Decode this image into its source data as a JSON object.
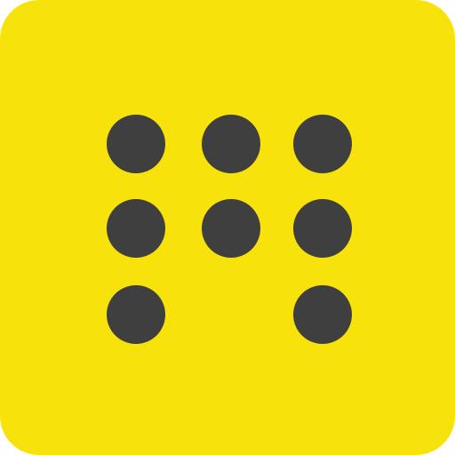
{
  "icon": {
    "name": "nine-dot-pattern-app-icon",
    "background_color": "#F8E20B",
    "dot_color": "#3F3F3F",
    "grid": {
      "rows": 3,
      "cols": 3,
      "filled": [
        [
          true,
          true,
          true
        ],
        [
          true,
          true,
          true
        ],
        [
          true,
          false,
          true
        ]
      ]
    }
  }
}
